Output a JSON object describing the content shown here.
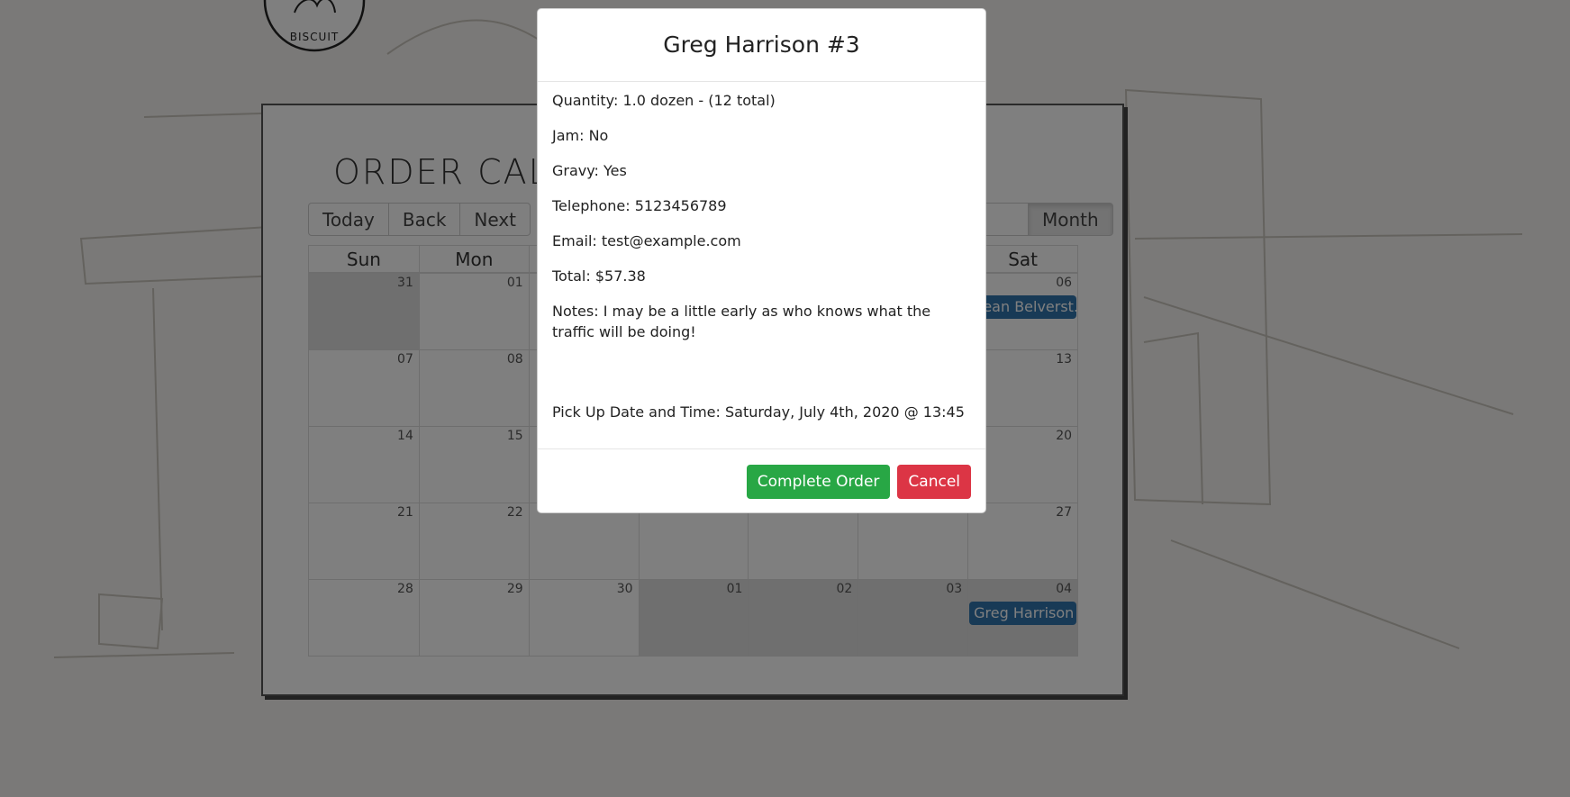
{
  "logo": {
    "text": "BISCUIT"
  },
  "calendar": {
    "title": "ORDER CAL",
    "nav": {
      "today": "Today",
      "back": "Back",
      "next": "Next"
    },
    "view": {
      "month": "Month"
    },
    "weekday_headers": [
      "Sun",
      "Mon",
      "",
      "",
      "",
      "",
      "Sat"
    ],
    "weeks": [
      {
        "days": [
          "31",
          "01",
          "",
          "",
          "",
          "",
          "06"
        ]
      },
      {
        "days": [
          "07",
          "08",
          "",
          "",
          "",
          "",
          "13"
        ]
      },
      {
        "days": [
          "14",
          "15",
          "",
          "",
          "",
          "",
          "20"
        ]
      },
      {
        "days": [
          "21",
          "22",
          "",
          "",
          "",
          "",
          "27"
        ]
      },
      {
        "days": [
          "28",
          "29",
          "30",
          "01",
          "02",
          "03",
          "04"
        ]
      }
    ],
    "events": {
      "week1_sat": "Sean Belverst...",
      "week5_sat": "Greg Harrison ..."
    }
  },
  "modal": {
    "title": "Greg Harrison #3",
    "quantity": "Quantity: 1.0 dozen - (12 total)",
    "jam": "Jam: No",
    "gravy": "Gravy: Yes",
    "telephone": "Telephone: 5123456789",
    "email": "Email: test@example.com",
    "total": "Total: $57.38",
    "notes": "Notes: I may be a little early as who knows what the traffic will be doing!",
    "pickup": "Pick Up Date and Time: Saturday, July 4th, 2020 @ 13:45",
    "complete_label": "Complete Order",
    "cancel_label": "Cancel"
  },
  "colors": {
    "event": "#3174ad",
    "success": "#28a745",
    "danger": "#dc3545",
    "off_range": "#dedede"
  }
}
